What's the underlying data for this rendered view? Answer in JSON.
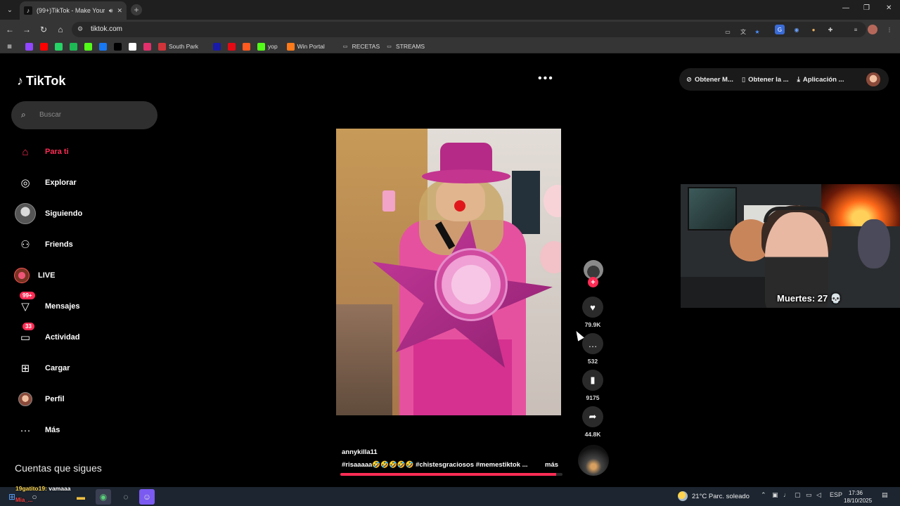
{
  "browser": {
    "tab_title": "(99+)TikTok - Make Your D...",
    "url": "tiktok.com",
    "bookmarks": [
      {
        "label": "",
        "color": "#9146ff"
      },
      {
        "label": "",
        "color": "#ff0000"
      },
      {
        "label": "",
        "color": "#25d366"
      },
      {
        "label": "",
        "color": "#1db954"
      },
      {
        "label": "",
        "color": "#53fc18"
      },
      {
        "label": "",
        "color": "#1877f2"
      },
      {
        "label": "",
        "color": "#000000"
      },
      {
        "label": "",
        "color": "#ffffff"
      },
      {
        "label": "",
        "color": "#e1306c"
      },
      {
        "label": "South Park",
        "color": "#d0343a"
      },
      {
        "label": "",
        "color": "#1a1aa8"
      },
      {
        "label": "",
        "color": "#e50914"
      },
      {
        "label": "",
        "color": "#ff5a1f"
      },
      {
        "label": "yop",
        "color": "#53fc18"
      },
      {
        "label": "Win Portal",
        "color": "#ff7a1a"
      },
      {
        "label": "RECETAS",
        "color": "folder"
      },
      {
        "label": "STREAMS",
        "color": "folder"
      }
    ]
  },
  "tiktok": {
    "logo": "TikTok",
    "search_placeholder": "Buscar",
    "nav": [
      {
        "label": "Para ti",
        "icon": "home-icon",
        "active": true
      },
      {
        "label": "Explorar",
        "icon": "compass-icon"
      },
      {
        "label": "Siguiendo",
        "icon": "following-avatar"
      },
      {
        "label": "Friends",
        "icon": "friends-icon"
      },
      {
        "label": "LIVE",
        "icon": "live-avatar"
      },
      {
        "label": "Mensajes",
        "icon": "message-icon",
        "badge": "99+"
      },
      {
        "label": "Actividad",
        "icon": "activity-icon",
        "badge": "33"
      },
      {
        "label": "Cargar",
        "icon": "upload-icon"
      },
      {
        "label": "Perfil",
        "icon": "profile-avatar"
      },
      {
        "label": "Más",
        "icon": "more-icon"
      }
    ],
    "following_header": "Cuentas que sigues",
    "top_buttons": [
      "Obtener M...",
      "Obtener la ...",
      "Aplicación ..."
    ],
    "video": {
      "author": "annykilla11",
      "caption": "#risaaaaa🤣🤣🤣🤣🤣  #chistesgraciosos  #memestiktok  ...",
      "more": "más",
      "progress": 0.97
    },
    "actions": {
      "likes": "79.9K",
      "comments": "532",
      "saves": "9175",
      "shares": "44.8K"
    }
  },
  "overlay": {
    "deaths_label": "Muertes: 27 💀",
    "chat_user": "19gatito19:",
    "chat_message": "vamaaa",
    "chat_line2": "Mia_..."
  },
  "taskbar": {
    "weather": "21°C  Parc. soleado",
    "language": "ESP",
    "time": "17:36",
    "date": "18/10/2025"
  }
}
